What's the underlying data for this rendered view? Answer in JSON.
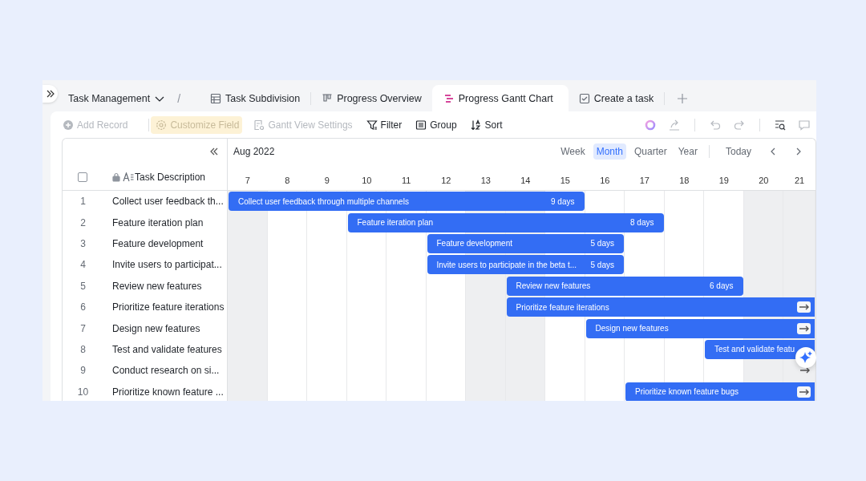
{
  "workspace": {
    "title": "Task Management"
  },
  "breadcrumb_separator": "/",
  "select_all": {
    "checked": false
  },
  "tabs": [
    {
      "label": "Task Subdivision",
      "kind": "table",
      "selected": false
    },
    {
      "label": "Progress Overview",
      "kind": "kanban",
      "selected": false
    },
    {
      "label": "Progress Gantt Chart",
      "kind": "gantt",
      "selected": true
    },
    {
      "label": "Create a task",
      "kind": "form",
      "selected": false
    }
  ],
  "toolbar": [
    {
      "label": "Add Record",
      "kind": "add",
      "disabled": true,
      "highlighted": false
    },
    {
      "label": "Customize Field",
      "kind": "fields",
      "disabled": true,
      "highlighted": true
    },
    {
      "label": "Gantt View Settings",
      "kind": "settings",
      "disabled": true,
      "highlighted": false
    },
    {
      "label": "Filter",
      "kind": "filter",
      "disabled": false,
      "highlighted": false
    },
    {
      "label": "Group",
      "kind": "group",
      "disabled": false,
      "highlighted": false
    },
    {
      "label": "Sort",
      "kind": "sort",
      "disabled": false,
      "highlighted": false
    }
  ],
  "timeline": {
    "month": "Aug 2022",
    "scales": [
      {
        "label": "Week",
        "selected": false
      },
      {
        "label": "Month",
        "selected": true
      },
      {
        "label": "Quarter",
        "selected": false
      },
      {
        "label": "Year",
        "selected": false
      }
    ],
    "today": "Today",
    "days": [
      {
        "label": "7",
        "weekend": true
      },
      {
        "label": "8",
        "weekend": false
      },
      {
        "label": "9",
        "weekend": false
      },
      {
        "label": "10",
        "weekend": false
      },
      {
        "label": "11",
        "weekend": false
      },
      {
        "label": "12",
        "weekend": false
      },
      {
        "label": "13",
        "weekend": true
      },
      {
        "label": "14",
        "weekend": true
      },
      {
        "label": "15",
        "weekend": false
      },
      {
        "label": "16",
        "weekend": false
      },
      {
        "label": "17",
        "weekend": false
      },
      {
        "label": "18",
        "weekend": false
      },
      {
        "label": "19",
        "weekend": false
      },
      {
        "label": "20",
        "weekend": true
      },
      {
        "label": "21",
        "weekend": true
      }
    ]
  },
  "table": {
    "column": "Task Description",
    "rows": [
      {
        "number": "1",
        "task": "Collect user feedback th...",
        "bar": {
          "label": "Collect user feedback through multiple channels",
          "duration": "9 days",
          "continues": false
        }
      },
      {
        "number": "2",
        "task": "Feature iteration plan",
        "bar": {
          "label": "Feature iteration plan",
          "duration": "8 days",
          "continues": false
        }
      },
      {
        "number": "3",
        "task": "Feature development",
        "bar": {
          "label": "Feature development",
          "duration": "5 days",
          "continues": false
        }
      },
      {
        "number": "4",
        "task": "Invite users to participat...",
        "bar": {
          "label": "Invite users to participate in the beta t...",
          "duration": "5 days",
          "continues": false
        }
      },
      {
        "number": "5",
        "task": "Review new features",
        "bar": {
          "label": "Review new features",
          "duration": "6 days",
          "continues": false
        }
      },
      {
        "number": "6",
        "task": "Prioritize feature iterations",
        "bar": {
          "label": "Prioritize feature iterations",
          "continues": true
        }
      },
      {
        "number": "7",
        "task": "Design new features",
        "bar": {
          "label": "Design new features",
          "continues": true
        }
      },
      {
        "number": "8",
        "task": "Test and validate features",
        "bar": {
          "label": "Test and validate featu",
          "continues": true,
          "arrow_button": false
        }
      },
      {
        "number": "9",
        "task": "Conduct research on si...",
        "bar": {
          "continues": true
        }
      },
      {
        "number": "10",
        "task": "Prioritize known feature ...",
        "bar": {
          "label": "Prioritize known feature bugs",
          "continues": true
        }
      }
    ]
  }
}
